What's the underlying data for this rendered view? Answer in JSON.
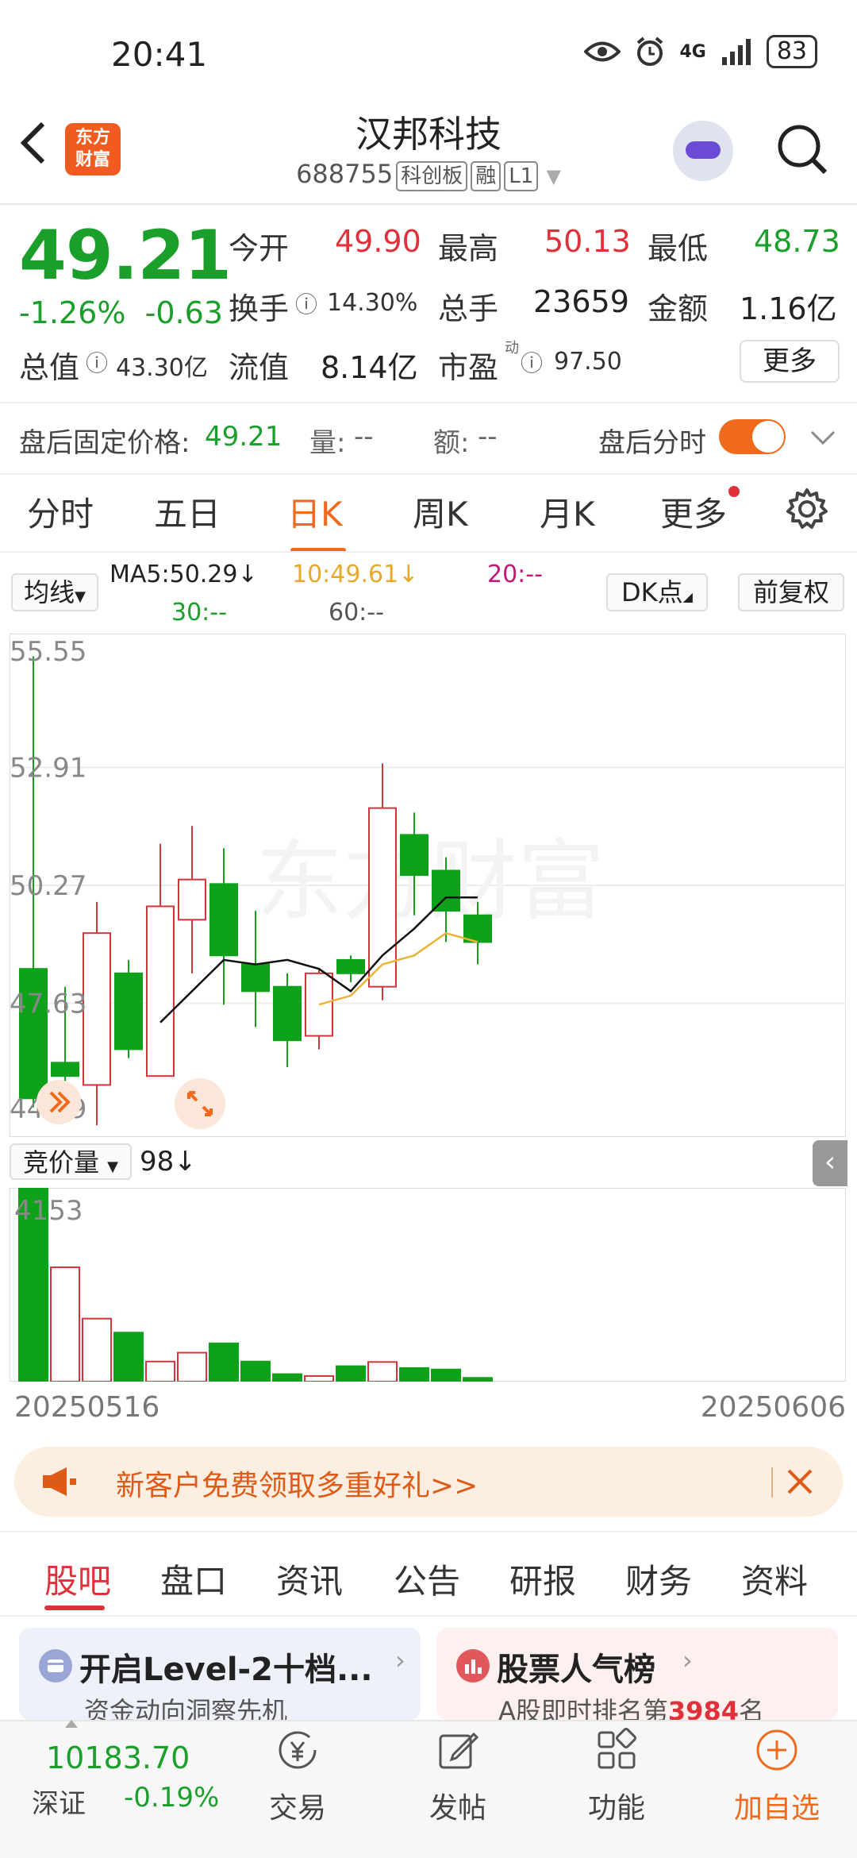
{
  "status_bar": {
    "time": "20:41",
    "network": "4G",
    "battery": "83"
  },
  "header": {
    "logo_text": "东方财富",
    "title": "汉邦科技",
    "code": "688755",
    "tags": [
      "科创板",
      "融",
      "L1"
    ]
  },
  "quote": {
    "price": "49.21",
    "change_pct": "-1.26%",
    "change_abs": "-0.63",
    "open_label": "今开",
    "open": "49.90",
    "high_label": "最高",
    "high": "50.13",
    "low_label": "最低",
    "low": "48.73",
    "turnover_label": "换手",
    "turnover": "14.30%",
    "volume_label": "总手",
    "volume": "23659",
    "amount_label": "金额",
    "amount": "1.16亿",
    "mktcap_label": "总值",
    "mktcap": "43.30亿",
    "float_label": "流值",
    "float": "8.14亿",
    "pe_label": "市盈",
    "pe_sup": "动",
    "pe": "97.50",
    "more_label": "更多"
  },
  "after_hours": {
    "price_label": "盘后固定价格:",
    "price": "49.21",
    "vol_label": "量:",
    "vol": "--",
    "amt_label": "额:",
    "amt": "--",
    "timeshare_label": "盘后分时",
    "toggle_on": true
  },
  "kline_tabs": [
    "分时",
    "五日",
    "日K",
    "周K",
    "月K",
    "更多"
  ],
  "active_tab": "日K",
  "ma_row": {
    "selector": "均线",
    "ma5": "MA5:50.29↓",
    "ma10": "10:49.61↓",
    "ma20": "20:--",
    "ma30": "30:--",
    "ma60": "60:--",
    "dk_label": "DK点",
    "adjust_label": "前复权",
    "colors": {
      "ma5": "#222222",
      "ma10": "#e8a92a",
      "ma20": "#c2187a",
      "ma30": "#1a9f2b",
      "ma60": "#555555"
    }
  },
  "volume_row": {
    "selector": "竞价量",
    "value": "98↓"
  },
  "chart_data": [
    {
      "type": "candlestick",
      "title": "",
      "ylim": [
        44.99,
        55.55
      ],
      "y_ticks": [
        "55.55",
        "52.91",
        "50.27",
        "47.63",
        "44.99"
      ],
      "watermark": "东方财富",
      "candles": [
        {
          "open": 48.4,
          "close": 45.5,
          "high": 55.4,
          "low": 45.3
        },
        {
          "open": 46.3,
          "close": 46.0,
          "high": 48.0,
          "low": 45.0
        },
        {
          "open": 45.8,
          "close": 49.2,
          "high": 49.9,
          "low": 44.9
        },
        {
          "open": 48.3,
          "close": 46.6,
          "high": 48.6,
          "low": 46.4
        },
        {
          "open": 46.0,
          "close": 49.8,
          "high": 51.2,
          "low": 46.0
        },
        {
          "open": 49.5,
          "close": 50.4,
          "high": 51.6,
          "low": 48.3
        },
        {
          "open": 50.3,
          "close": 48.7,
          "high": 51.1,
          "low": 47.6
        },
        {
          "open": 48.5,
          "close": 47.9,
          "high": 49.7,
          "low": 47.1
        },
        {
          "open": 48.0,
          "close": 46.8,
          "high": 48.3,
          "low": 46.2
        },
        {
          "open": 46.9,
          "close": 48.3,
          "high": 48.4,
          "low": 46.6
        },
        {
          "open": 48.6,
          "close": 48.3,
          "high": 48.7,
          "low": 48.1
        },
        {
          "open": 48.0,
          "close": 52.0,
          "high": 53.0,
          "low": 47.7
        },
        {
          "open": 51.4,
          "close": 50.5,
          "high": 51.9,
          "low": 49.6
        },
        {
          "open": 50.6,
          "close": 49.7,
          "high": 50.9,
          "low": 49.0
        },
        {
          "open": 49.6,
          "close": 49.0,
          "high": 49.9,
          "low": 48.5
        }
      ],
      "ma5": [
        null,
        null,
        null,
        null,
        47.2,
        47.9,
        48.6,
        48.5,
        48.6,
        48.4,
        47.9,
        48.7,
        49.3,
        50.0,
        50.0
      ],
      "ma10": [
        null,
        null,
        null,
        null,
        null,
        null,
        null,
        null,
        null,
        47.6,
        47.8,
        48.5,
        48.7,
        49.2,
        49.0
      ],
      "colors": {
        "up": "#d6343b",
        "down": "#0ea21b",
        "ma5": "#111111",
        "ma10": "#e8b437"
      }
    },
    {
      "type": "bar",
      "title": "竞价量",
      "y_ticks": [
        "4153"
      ],
      "ylim": [
        0,
        4153
      ],
      "values": [
        4153,
        2450,
        1350,
        1050,
        430,
        620,
        820,
        430,
        160,
        120,
        330,
        420,
        290,
        260,
        80
      ],
      "directions": [
        "down",
        "up",
        "up",
        "down",
        "up",
        "up",
        "down",
        "down",
        "down",
        "up",
        "down",
        "up",
        "down",
        "down",
        "down"
      ],
      "x_range": [
        "20250516",
        "20250606"
      ]
    }
  ],
  "promo": {
    "text": "新客户免费领取多重好礼>>"
  },
  "bottom_tabs": [
    "股吧",
    "盘口",
    "资讯",
    "公告",
    "研报",
    "财务",
    "资料"
  ],
  "active_bottom_tab": "股吧",
  "cards": [
    {
      "title": "开启Level-2十档...",
      "sub": "资金动向洞察先机"
    },
    {
      "title": "股票人气榜",
      "sub_prefix": "A股即时排名第",
      "rank": "3984",
      "sub_suffix": "名"
    }
  ],
  "bottom_nav": {
    "index_value": "10183.70",
    "index_name": "深证",
    "index_change": "-0.19%",
    "items": [
      "交易",
      "发帖",
      "功能",
      "加自选"
    ]
  }
}
